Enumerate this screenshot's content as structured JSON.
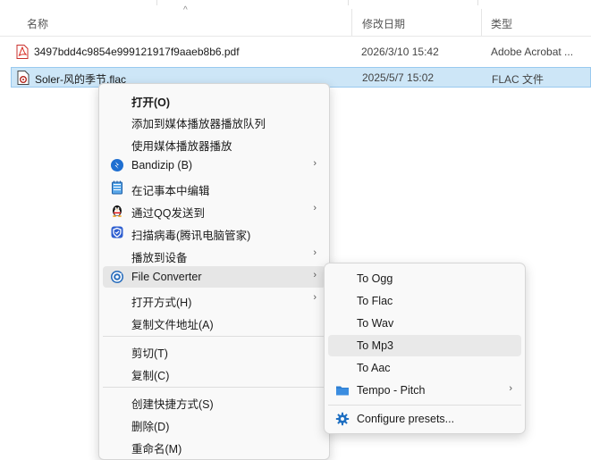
{
  "header": {
    "name_col": "名称",
    "date_col": "修改日期",
    "type_col": "类型",
    "sort_arrow": "^"
  },
  "files": [
    {
      "name": "3497bdd4c9854e999121917f9aaeb8b6.pdf",
      "date": "2026/3/10 15:42",
      "type": "Adobe Acrobat ...",
      "icon": "pdf-file-icon",
      "selected": false
    },
    {
      "name": "Soler-风的季节.flac",
      "date": "2025/5/7 15:02",
      "type": "FLAC 文件",
      "icon": "audio-file-icon",
      "selected": true
    }
  ],
  "context_menu": {
    "items": [
      {
        "label": "打开(O)",
        "bold": true
      },
      {
        "label": "添加到媒体播放器播放队列"
      },
      {
        "label": "使用媒体播放器播放"
      },
      {
        "label": "Bandizip (B)",
        "icon": "bandizip-icon",
        "submenu": true
      },
      {
        "label": "在记事本中编辑",
        "icon": "notepad-icon"
      },
      {
        "label": "通过QQ发送到",
        "icon": "qq-penguin-icon",
        "submenu": true
      },
      {
        "label": "扫描病毒(腾讯电脑管家)",
        "icon": "shield-icon"
      },
      {
        "label": "播放到设备",
        "submenu": true
      },
      {
        "label": "File Converter",
        "icon": "file-converter-icon",
        "submenu": true,
        "highlighted": true
      },
      {
        "label": "打开方式(H)",
        "submenu": true
      },
      {
        "label": "复制文件地址(A)"
      },
      {
        "label": "剪切(T)"
      },
      {
        "label": "复制(C)"
      },
      {
        "label": "创建快捷方式(S)"
      },
      {
        "label": "删除(D)"
      },
      {
        "label": "重命名(M)"
      }
    ]
  },
  "submenu": {
    "items": [
      {
        "label": "To Ogg"
      },
      {
        "label": "To Flac"
      },
      {
        "label": "To Wav"
      },
      {
        "label": "To Mp3",
        "highlighted": true
      },
      {
        "label": "To Aac"
      },
      {
        "label": "Tempo - Pitch",
        "icon": "folder-icon",
        "submenu": true
      },
      {
        "label": "Configure presets...",
        "icon": "gear-icon"
      }
    ]
  },
  "glyphs": {
    "chevron": "›"
  },
  "colors": {
    "selection_bg": "#cde6f7",
    "selection_border": "#99c9ef",
    "folder_blue": "#2e7fd3",
    "gear_blue": "#1e6fc2"
  }
}
